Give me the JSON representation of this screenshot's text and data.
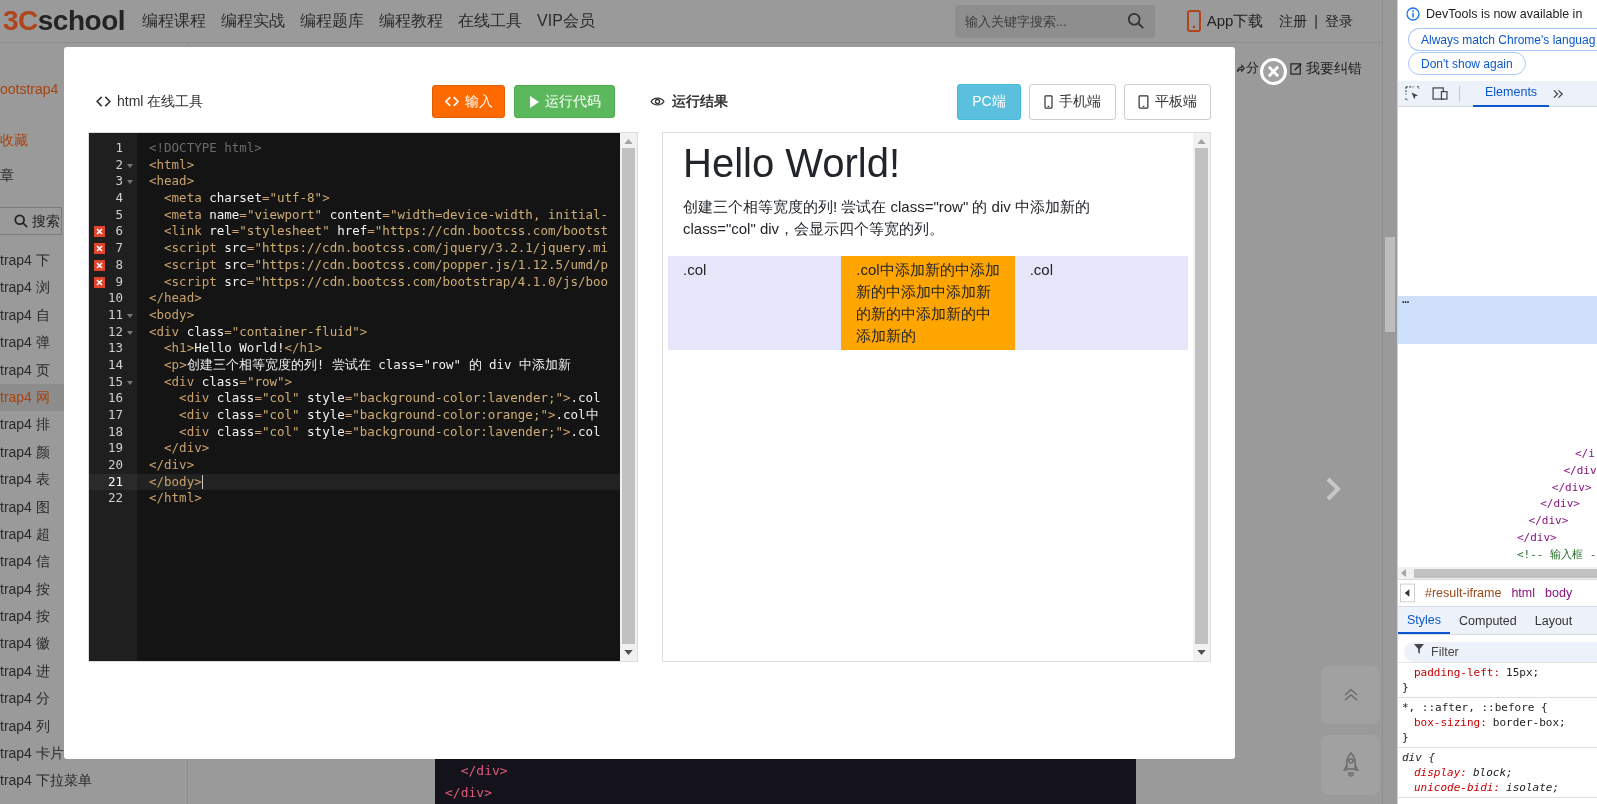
{
  "page": {
    "logo": {
      "accent": "3C",
      "rest": "school"
    },
    "nav_links": [
      "编程课程",
      "编程实战",
      "编程题库",
      "编程教程",
      "在线工具",
      "VIP会员"
    ],
    "search": {
      "placeholder": "输入关键字搜索..."
    },
    "app_download": "App下载",
    "register": "注册",
    "separator": "|",
    "login": "登录",
    "share": "分",
    "report": "我要纠错",
    "sidebar": {
      "breadcrumb": "ootstrap4",
      "favorite": "收藏",
      "chapter": "章",
      "search_button": "搜索",
      "items": [
        {
          "label": "trap4 下",
          "selected": false
        },
        {
          "label": "trap4 浏",
          "selected": false
        },
        {
          "label": "trap4 自",
          "selected": false
        },
        {
          "label": "trap4 弹",
          "selected": false
        },
        {
          "label": "trap4 页",
          "selected": false
        },
        {
          "label": "trap4 网",
          "selected": true
        },
        {
          "label": "trap4 排",
          "selected": false
        },
        {
          "label": "trap4 颜",
          "selected": false
        },
        {
          "label": "trap4 表",
          "selected": false
        },
        {
          "label": "trap4 图",
          "selected": false
        },
        {
          "label": "trap4 超",
          "selected": false
        },
        {
          "label": "trap4 信",
          "selected": false
        },
        {
          "label": "trap4 按",
          "selected": false
        },
        {
          "label": "trap4 按",
          "selected": false
        },
        {
          "label": "trap4 徽",
          "selected": false
        },
        {
          "label": "trap4 进",
          "selected": false
        },
        {
          "label": "trap4 分",
          "selected": false
        },
        {
          "label": "trap4 列",
          "selected": false
        },
        {
          "label": "trap4 卡片",
          "selected": false
        },
        {
          "label": "trap4 下拉菜单",
          "selected": false
        }
      ]
    },
    "code_preview": [
      "  </div>",
      "</div>"
    ]
  },
  "modal": {
    "title": "html 在线工具",
    "input_button": "输入",
    "run_button": "运行代码",
    "result_title": "运行结果",
    "devices": [
      {
        "label": "PC端",
        "kind": "pc",
        "selected": true
      },
      {
        "label": "手机端",
        "kind": "phone",
        "selected": false
      },
      {
        "label": "平板端",
        "kind": "tablet",
        "selected": false
      }
    ],
    "editor": {
      "lines": [
        {
          "number": "1",
          "text": "<!DOCTYPE html>",
          "error": false,
          "foldable": false,
          "active": false
        },
        {
          "number": "2",
          "text": "<html>",
          "error": false,
          "foldable": true,
          "active": false
        },
        {
          "number": "3",
          "text": "<head>",
          "error": false,
          "foldable": true,
          "active": false
        },
        {
          "number": "4",
          "text": "  <meta charset=\"utf-8\">",
          "error": false,
          "foldable": false,
          "active": false
        },
        {
          "number": "5",
          "text": "  <meta name=\"viewport\" content=\"width=device-width, initial-",
          "error": false,
          "foldable": false,
          "active": false
        },
        {
          "number": "6",
          "text": "  <link rel=\"stylesheet\" href=\"https://cdn.bootcss.com/bootst",
          "error": true,
          "foldable": false,
          "active": false
        },
        {
          "number": "7",
          "text": "  <script src=\"https://cdn.bootcss.com/jquery/3.2.1/jquery.mi",
          "error": true,
          "foldable": false,
          "active": false
        },
        {
          "number": "8",
          "text": "  <script src=\"https://cdn.bootcss.com/popper.js/1.12.5/umd/p",
          "error": true,
          "foldable": false,
          "active": false
        },
        {
          "number": "9",
          "text": "  <script src=\"https://cdn.bootcss.com/bootstrap/4.1.0/js/boo",
          "error": true,
          "foldable": false,
          "active": false
        },
        {
          "number": "10",
          "text": "</head>",
          "error": false,
          "foldable": false,
          "active": false
        },
        {
          "number": "11",
          "text": "<body>",
          "error": false,
          "foldable": true,
          "active": false
        },
        {
          "number": "12",
          "text": "<div class=\"container-fluid\">",
          "error": false,
          "foldable": true,
          "active": false
        },
        {
          "number": "13",
          "text": "  <h1>Hello World!</h1>",
          "error": false,
          "foldable": false,
          "active": false
        },
        {
          "number": "14",
          "text": "  <p>创建三个相等宽度的列! 尝试在 class=\"row\" 的 div 中添加新",
          "error": false,
          "foldable": false,
          "active": false
        },
        {
          "number": "15",
          "text": "  <div class=\"row\">",
          "error": false,
          "foldable": true,
          "active": false
        },
        {
          "number": "16",
          "text": "    <div class=\"col\" style=\"background-color:lavender;\">.col",
          "error": false,
          "foldable": false,
          "active": false
        },
        {
          "number": "17",
          "text": "    <div class=\"col\" style=\"background-color:orange;\">.col中",
          "error": false,
          "foldable": false,
          "active": false
        },
        {
          "number": "18",
          "text": "    <div class=\"col\" style=\"background-color:lavender;\">.col",
          "error": false,
          "foldable": false,
          "active": false
        },
        {
          "number": "19",
          "text": "  </div>",
          "error": false,
          "foldable": false,
          "active": false
        },
        {
          "number": "20",
          "text": "</div>",
          "error": false,
          "foldable": false,
          "active": false
        },
        {
          "number": "21",
          "text": "</body>",
          "error": false,
          "foldable": false,
          "active": true
        },
        {
          "number": "22",
          "text": "</html>",
          "error": false,
          "foldable": false,
          "active": false
        }
      ]
    },
    "result": {
      "heading": "Hello World!",
      "paragraph": "创建三个相等宽度的列! 尝试在 class=\"row\" 的 div 中添加新的 class=\"col\" div，会显示四个等宽的列。",
      "columns": [
        {
          "text": ".col",
          "color": "#e6e6fa"
        },
        {
          "text": ".col中添加新的中添加新的中添加中添加新的新的中添加新的中添加新的",
          "color": "#ffa500"
        },
        {
          "text": ".col",
          "color": "#e6e6fa"
        }
      ]
    }
  },
  "devtools": {
    "notice": "DevTools is now available in",
    "language_button": "Always match Chrome's languag",
    "dismiss_button": "Don't show again",
    "tabs": [
      {
        "label": "Elements",
        "selected": true
      }
    ],
    "selected_row": "…",
    "tree": [
      {
        "text": "</div>",
        "kind": "tag",
        "children": [
          {
            "text": "</div>",
            "kind": "tag",
            "children": [
              {
                "text": "</div>",
                "kind": "tag",
                "children": [
                  {
                    "text": "</div>",
                    "kind": "tag",
                    "children": [
                      {
                        "text": "</div",
                        "kind": "tag",
                        "children": [
                          {
                            "text": "</i",
                            "kind": "tag"
                          }
                        ]
                      }
                    ]
                  }
                ]
              }
            ]
          }
        ]
      },
      {
        "text": "<!-- 输入框 -",
        "kind": "comment"
      }
    ],
    "breadcrumb": [
      {
        "text": "#result-iframe",
        "kind": "frame"
      },
      {
        "text": "html",
        "kind": "tag"
      },
      {
        "text": "body",
        "kind": "tag"
      }
    ],
    "panel_tabs": [
      {
        "label": "Styles",
        "selected": true
      },
      {
        "label": "Computed",
        "selected": false
      },
      {
        "label": "Layout",
        "selected": false
      }
    ],
    "filter": {
      "placeholder": "Filter"
    },
    "rules": [
      {
        "declarations": [
          {
            "property": "padding-left:",
            "value": "15px;"
          }
        ],
        "closing": "}",
        "italic": false
      },
      {
        "selector": "*, ::after, ::before {",
        "declarations": [
          {
            "property": "box-sizing:",
            "value": "border-box;"
          }
        ],
        "closing": "}",
        "italic": false
      },
      {
        "selector": "div {",
        "declarations": [
          {
            "property": "display:",
            "value": "block;"
          },
          {
            "property": "unicode-bidi:",
            "value": "isolate;"
          }
        ],
        "italic": true
      }
    ]
  }
}
